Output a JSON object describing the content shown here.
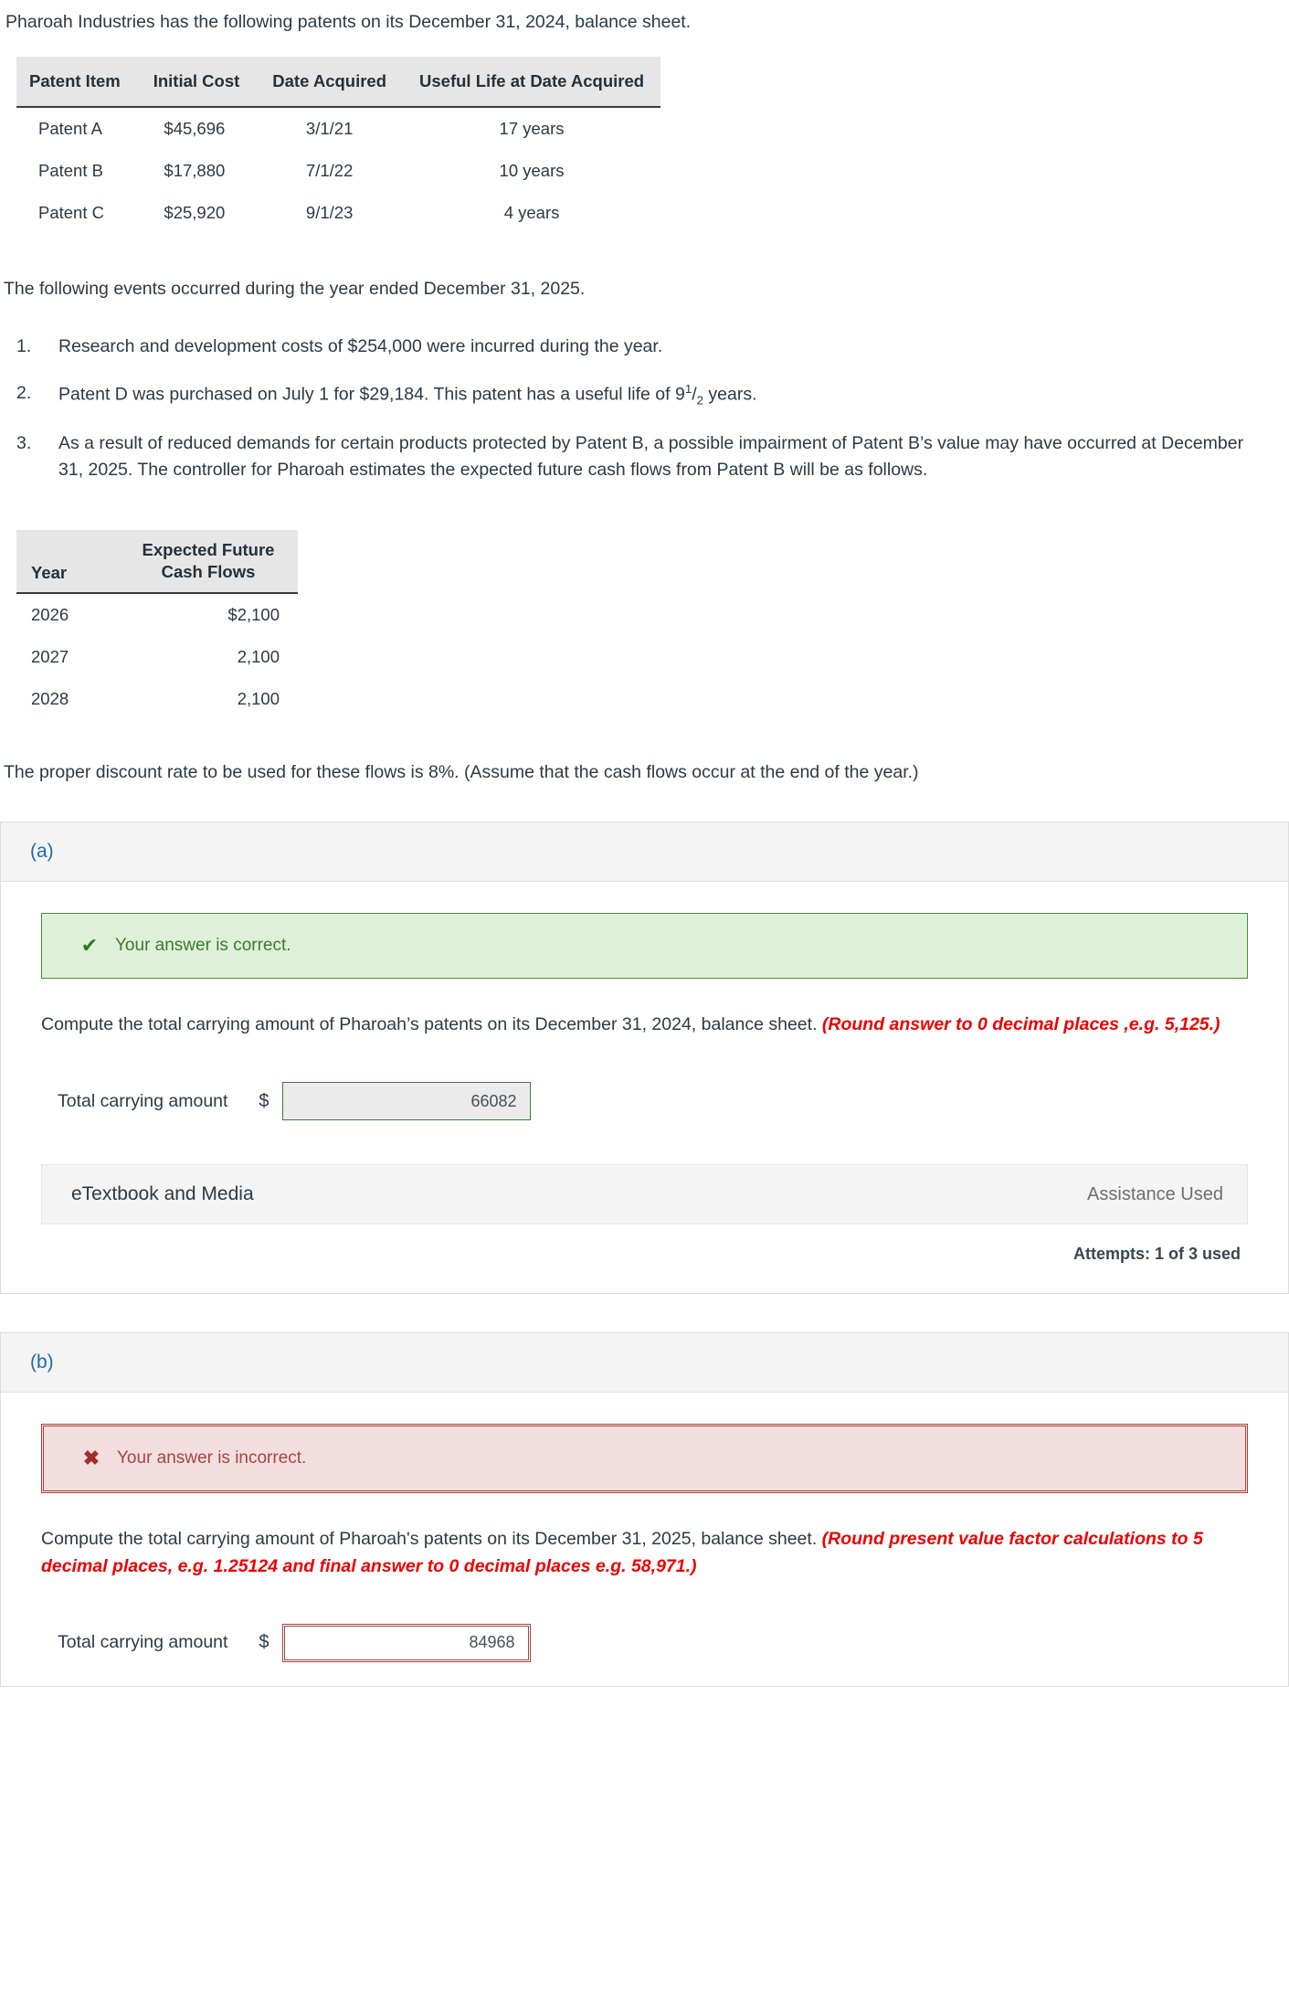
{
  "intro": "Pharoah Industries has the following patents on its December 31, 2024, balance sheet.",
  "patents_table": {
    "headers": [
      "Patent Item",
      "Initial Cost",
      "Date Acquired",
      "Useful Life at Date Acquired"
    ],
    "rows": [
      {
        "item": "Patent A",
        "cost": "$45,696",
        "date": "3/1/21",
        "life": "17 years"
      },
      {
        "item": "Patent B",
        "cost": "$17,880",
        "date": "7/1/22",
        "life": "10 years"
      },
      {
        "item": "Patent C",
        "cost": "$25,920",
        "date": "9/1/23",
        "life": "4 years"
      }
    ]
  },
  "events_lead": "The following events occurred during the year ended December 31, 2025.",
  "events": [
    {
      "num": "1.",
      "text": "Research and development costs of $254,000 were incurred during the year."
    },
    {
      "num": "2.",
      "pre": "Patent D was purchased on July 1 for $29,184. This patent has a useful life of 9",
      "sup": "1",
      "slash": "/",
      "sub": "2",
      "post": " years."
    },
    {
      "num": "3.",
      "text": "As a result of reduced demands for certain products protected by Patent B, a possible impairment of Patent B’s value may have occurred at December 31, 2025. The controller for Pharoah estimates the expected future cash flows from Patent B will be as follows."
    }
  ],
  "cash_table": {
    "headers": [
      "Year",
      "Expected Future Cash Flows"
    ],
    "header_cf_line1": "Expected Future",
    "header_cf_line2": "Cash Flows",
    "rows": [
      {
        "year": "2026",
        "value": "$2,100"
      },
      {
        "year": "2027",
        "value": "2,100"
      },
      {
        "year": "2028",
        "value": "2,100"
      }
    ]
  },
  "discount_note": "The proper discount rate to be used for these flows is 8%. (Assume that the cash flows occur at the end of the year.)",
  "part_a": {
    "label": "(a)",
    "alert_icon": "✔",
    "alert_text": "Your answer is correct.",
    "prompt_plain": "Compute the total carrying amount of Pharoah’s patents on its December 31, 2024, balance sheet. ",
    "prompt_hint": "(Round answer to 0 decimal places ,e.g. 5,125.)",
    "answer_label": "Total carrying amount",
    "currency": "$",
    "answer_value": "66082",
    "etextbook_label": "eTextbook and Media",
    "assistance_label": "Assistance Used",
    "attempts_label": "Attempts: 1 of 3 used"
  },
  "part_b": {
    "label": "(b)",
    "alert_icon": "✖",
    "alert_text": "Your answer is incorrect.",
    "prompt_plain": "Compute the total carrying amount of Pharoah's patents on its December 31, 2025, balance sheet. ",
    "prompt_hint": "(Round present value factor calculations to 5 decimal places, e.g. 1.25124 and final answer to 0 decimal places e.g. 58,971.)",
    "answer_label": "Total carrying amount",
    "currency": "$",
    "answer_value": "84968"
  },
  "colors": {
    "accent_blue": "#1b6ca8",
    "hint_red": "#ee0000",
    "success_green": "#3c7a30",
    "error_red": "#a94442",
    "table_header_bg": "#e6e6e6"
  }
}
